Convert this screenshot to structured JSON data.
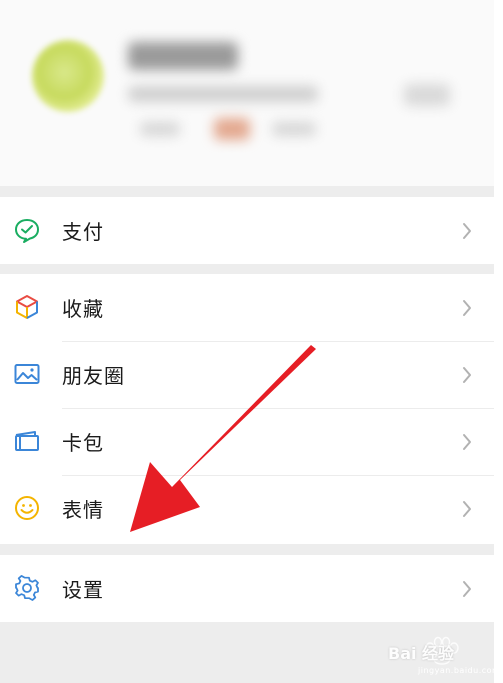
{
  "menu": {
    "items": [
      {
        "label": "支付",
        "icon": "payment-icon"
      },
      {
        "label": "收藏",
        "icon": "favorites-cube-icon"
      },
      {
        "label": "朋友圈",
        "icon": "moments-picture-icon"
      },
      {
        "label": "卡包",
        "icon": "card-wallet-icon"
      },
      {
        "label": "表情",
        "icon": "sticker-smile-icon"
      },
      {
        "label": "设置",
        "icon": "settings-gear-icon"
      }
    ]
  },
  "watermark": {
    "brand": "Bai 经验",
    "url": "jingyan.baidu.com"
  },
  "colors": {
    "pay_green": "#1aad61",
    "arrow_red": "#e61e25",
    "settings_blue": "#3b86d8"
  }
}
